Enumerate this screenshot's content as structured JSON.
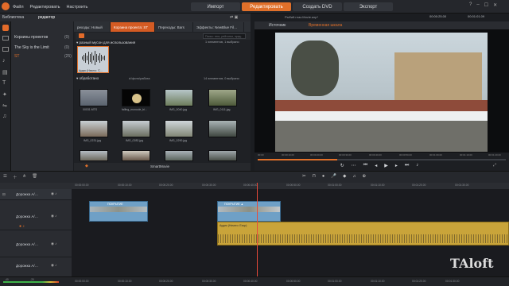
{
  "menu": [
    "Файл",
    "Редактировать",
    "Настроить"
  ],
  "modes": [
    {
      "label": "Импорт",
      "active": false
    },
    {
      "label": "Редактировать",
      "active": true
    },
    {
      "label": "Создать DVD",
      "active": false
    },
    {
      "label": "Экспорт",
      "active": false
    }
  ],
  "window_title": "Рыбий глаз.Movie.axp*",
  "library": {
    "tab_library": "Библиотека",
    "tab_editor": "редактор",
    "tree": [
      {
        "label": "Корзины проектов",
        "count": "(0)"
      },
      {
        "label": "The Sky is the Limit",
        "count": "(0)"
      },
      {
        "label": "ST",
        "count": "(25)"
      }
    ]
  },
  "browser": {
    "tabs": [
      "реходы: Новый",
      "Корзина проекта: ST",
      "Переходы: Bars",
      "Эффекты: NewBlue Fil…"
    ],
    "search_placeholder": "Поиск: теги, рейтинги, пред-появ…",
    "summary_top": "1 элементов, 1 выбрано",
    "section1": "разный мусон для использования",
    "clip1_caption": "Аудио (Ничего: 'С…",
    "section2": "обработано",
    "path": "d:\\фото\\работа",
    "summary2": "14 элементов, 0 выбрано",
    "thumbs": [
      "00031.MTS",
      "falling_monocle_bi…",
      "IMG_0040.jpg",
      "IMG_0111.jpg",
      "IMG_0231.jpg",
      "IMG_0282.jpg",
      "IMG_0290.jpg",
      "",
      "",
      "",
      "",
      ""
    ],
    "smartmovie": "SmartMovie"
  },
  "preview": {
    "tab_source": "Источник",
    "tab_timeline": "Временная шкала",
    "ruler": [
      "00:00",
      "00:00:10.00",
      "00:00:20.00",
      "00:00:30.00",
      "00:00:40.00",
      "00:00:50.00",
      "00:01:00.00",
      "00:01:10.00",
      "00:01:20.00"
    ],
    "timecode": "00:00:25.00",
    "duration": "00:01:01.09"
  },
  "timeline": {
    "ruler": [
      "00:00:00.00",
      "00:00:10.00",
      "00:00:20.00",
      "00:00:30.00",
      "00:00:40.00",
      "00:00:50.00",
      "00:01:00.00",
      "00:01:10.00",
      "00:01:20.00",
      "00:01:30.00"
    ],
    "tracks": [
      "Дорожка А/…",
      "Дорожка А/…",
      "Дорожка А/…",
      "Дорожка А/…"
    ],
    "clip_labels": [
      "ПОКРЫТИЕ",
      "ПОКРЫТИЕ ▲",
      "Аудио (Ничего: Ехор)"
    ],
    "bottom_ruler": [
      "-40",
      "-20",
      "00:00:00.00",
      "00:00:10.00",
      "00:00:20.00",
      "00:00:30.00",
      "00:00:40.00",
      "00:00:50.00",
      "00:01:00.00",
      "00:01:10.00",
      "00:01:20.00",
      "00:01:30.00"
    ]
  },
  "watermark": "TAloft",
  "colors": {
    "accent": "#e0702a",
    "clip_video": "#6fa0c6",
    "clip_audio": "#c9a43a"
  }
}
